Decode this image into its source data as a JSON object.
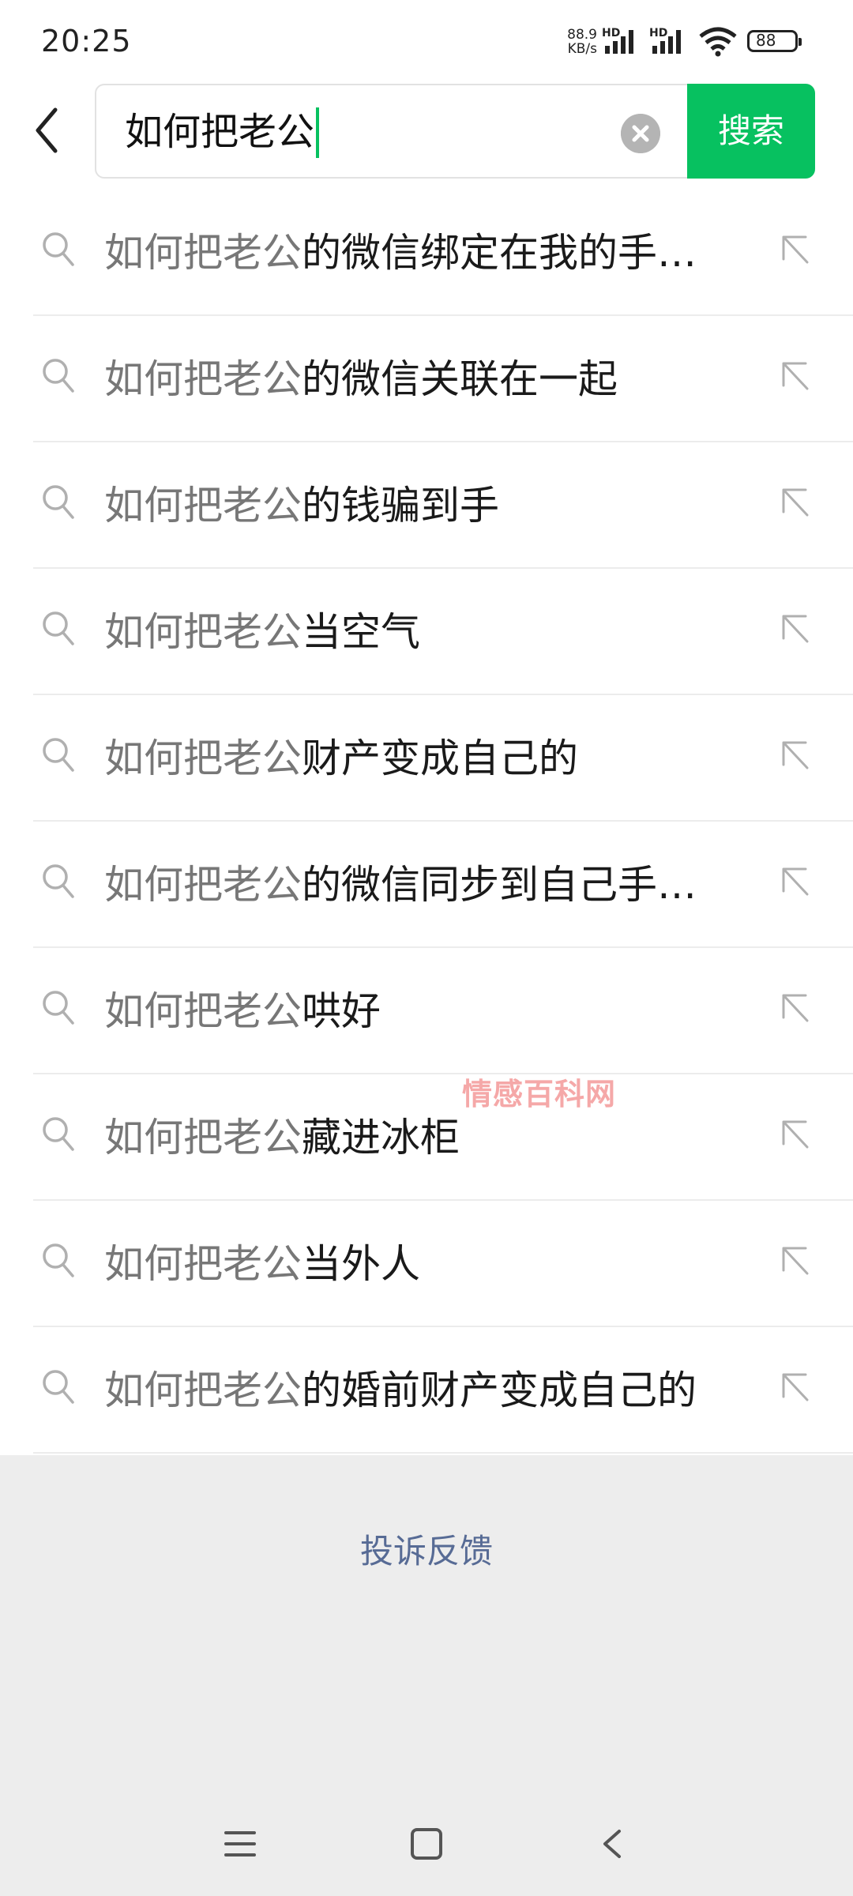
{
  "status_bar": {
    "time": "20:25",
    "net_speed": "88.9",
    "net_unit": "KB/s",
    "hd1": "HD",
    "hd2": "HD",
    "battery": "88"
  },
  "search": {
    "query": "如何把老公",
    "button_label": "搜索"
  },
  "suggestions": [
    {
      "prefix": "如何把老公",
      "suffix": "的微信绑定在我的手…"
    },
    {
      "prefix": "如何把老公",
      "suffix": "的微信关联在一起"
    },
    {
      "prefix": "如何把老公",
      "suffix": "的钱骗到手"
    },
    {
      "prefix": "如何把老公",
      "suffix": "当空气"
    },
    {
      "prefix": "如何把老公",
      "suffix": "财产变成自己的"
    },
    {
      "prefix": "如何把老公",
      "suffix": "的微信同步到自己手…"
    },
    {
      "prefix": "如何把老公",
      "suffix": "哄好"
    },
    {
      "prefix": "如何把老公",
      "suffix": "藏进冰柜"
    },
    {
      "prefix": "如何把老公",
      "suffix": "当外人"
    },
    {
      "prefix": "如何把老公",
      "suffix": "的婚前财产变成自己的"
    }
  ],
  "watermark": "情感百科网",
  "feedback_label": "投诉反馈",
  "colors": {
    "accent": "#07c160",
    "link": "#576b95",
    "background": "#ededed"
  },
  "icons": {
    "back": "chevron-left-icon",
    "clear": "clear-icon",
    "suggestion": "search-icon",
    "fill": "arrow-up-left-icon",
    "nav_menu": "menu-icon",
    "nav_home": "home-icon",
    "nav_back": "nav-back-icon"
  }
}
